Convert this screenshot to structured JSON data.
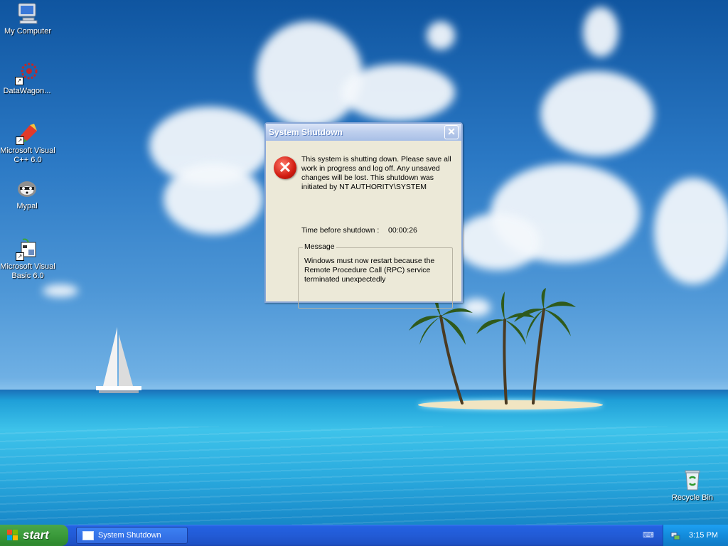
{
  "desktop": {
    "icons": [
      {
        "label": "My Computer"
      },
      {
        "label": "DataWagon..."
      },
      {
        "label": "Microsoft Visual C++ 6.0"
      },
      {
        "label": "Mypal"
      },
      {
        "label": "Microsoft Visual Basic 6.0"
      },
      {
        "label": "Recycle Bin"
      }
    ]
  },
  "dialog": {
    "title": "System Shutdown",
    "close_symbol": "✕",
    "message": "This system is shutting down. Please save all work in progress and log off. Any unsaved changes will be lost. This shutdown was initiated by NT AUTHORITY\\SYSTEM",
    "timer_label": "Time before shutdown :",
    "timer_value": "00:00:26",
    "message_group_label": "Message",
    "message_group_text": "Windows must now restart because the Remote Procedure Call (RPC) service terminated unexpectedly"
  },
  "taskbar": {
    "start_label": "start",
    "task_button_label": "System Shutdown",
    "clock": "3:15 PM"
  },
  "colors": {
    "taskbar_blue": "#245edb",
    "start_green": "#3c9c3c",
    "dialog_face": "#ece9d8",
    "error_red": "#d11b10"
  }
}
